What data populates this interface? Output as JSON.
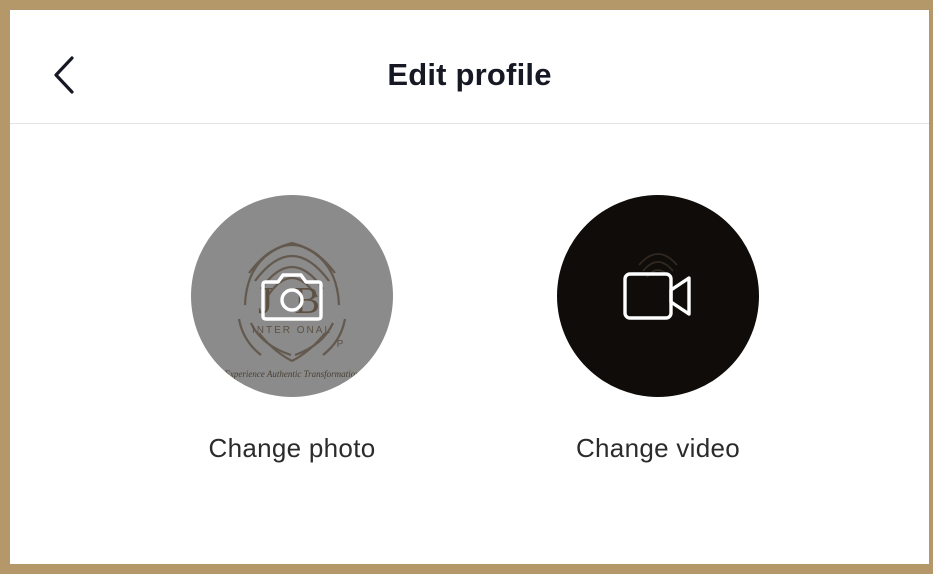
{
  "header": {
    "title": "Edit profile",
    "back_icon": "chevron-left-icon"
  },
  "options": {
    "photo": {
      "label": "Change photo",
      "icon": "camera-icon",
      "logo": {
        "main": "J    B",
        "line1": "INTER    ONAL",
        "line2": "P",
        "tagline": "Experience Authentic Transformation"
      }
    },
    "video": {
      "label": "Change video",
      "icon": "video-camera-icon"
    }
  },
  "colors": {
    "frame": "#b5986a",
    "photo_circle": "#8b8b8b",
    "video_circle": "#0f0c09",
    "text": "#161823"
  }
}
